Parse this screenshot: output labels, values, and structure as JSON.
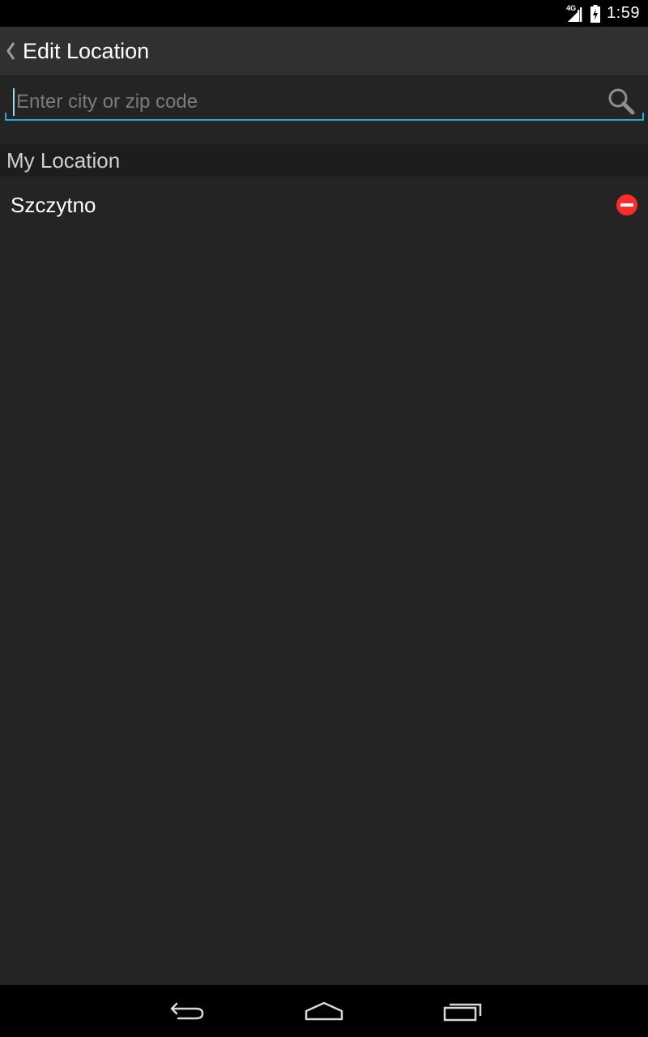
{
  "status_bar": {
    "network_label": "4G",
    "network_icon": "signal-icon",
    "battery_icon": "battery-charging-icon",
    "time": "1:59"
  },
  "action_bar": {
    "up_icon": "chevron-left-icon",
    "title": "Edit Location"
  },
  "search": {
    "placeholder": "Enter city or zip code",
    "value": "",
    "icon": "search-icon",
    "accent_color": "#2ea8d9"
  },
  "section": {
    "title": "My Location"
  },
  "locations": [
    {
      "name": "Szczytno",
      "action_icon": "remove-icon",
      "action_color": "#ff2b2b"
    }
  ],
  "nav_bar": {
    "back_icon": "back-icon",
    "home_icon": "home-icon",
    "recents_icon": "recents-icon"
  },
  "colors": {
    "background": "#232423",
    "action_bar": "#2f302f",
    "section_header": "#1c1e1d",
    "status_bar": "#000000"
  }
}
